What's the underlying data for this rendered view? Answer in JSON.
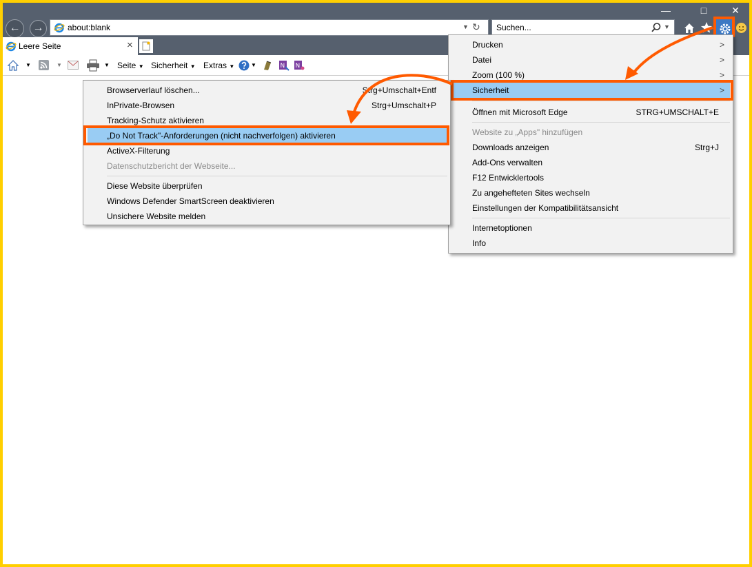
{
  "window": {
    "minimize": "—",
    "maximize": "□",
    "close": "✕"
  },
  "nav": {
    "back_icon": "←",
    "forward_icon": "→"
  },
  "address": {
    "url": "about:blank",
    "refresh_icon": "↻"
  },
  "search": {
    "placeholder": "Suchen..."
  },
  "tab": {
    "title": "Leere Seite",
    "close": "×"
  },
  "command_bar": {
    "seite": "Seite",
    "sicherheit": "Sicherheit",
    "extras": "Extras"
  },
  "tools_menu": {
    "items": [
      {
        "label": "Drucken"
      },
      {
        "label": "Datei"
      },
      {
        "label": "Zoom (100 %)"
      },
      {
        "label": "Sicherheit"
      },
      {
        "label": "Öffnen mit Microsoft Edge",
        "shortcut": "STRG+UMSCHALT+E"
      },
      {
        "label": "Website zu „Apps\" hinzufügen"
      },
      {
        "label": "Downloads anzeigen",
        "shortcut": "Strg+J"
      },
      {
        "label": "Add-Ons verwalten"
      },
      {
        "label": "F12 Entwicklertools"
      },
      {
        "label": "Zu angehefteten Sites wechseln"
      },
      {
        "label": "Einstellungen der Kompatibilitätsansicht"
      },
      {
        "label": "Internetoptionen"
      },
      {
        "label": "Info"
      }
    ],
    "submenu_arrow": ">"
  },
  "security_submenu": {
    "items": [
      {
        "label": "Browserverlauf löschen...",
        "shortcut": "Strg+Umschalt+Entf"
      },
      {
        "label": "InPrivate-Browsen",
        "shortcut": "Strg+Umschalt+P"
      },
      {
        "label": "Tracking-Schutz aktivieren"
      },
      {
        "label": "„Do Not Track\"-Anforderungen (nicht nachverfolgen) aktivieren"
      },
      {
        "label": "ActiveX-Filterung"
      },
      {
        "label": "Datenschutzbericht der Webseite..."
      },
      {
        "label": "Diese Website überprüfen"
      },
      {
        "label": "Windows Defender SmartScreen deaktivieren"
      },
      {
        "label": "Unsichere Website melden"
      }
    ]
  },
  "colors": {
    "frame": "#ffcf00",
    "highlight": "#99ccf3",
    "annotation": "#ff5a00",
    "chrome": "#56606e"
  }
}
